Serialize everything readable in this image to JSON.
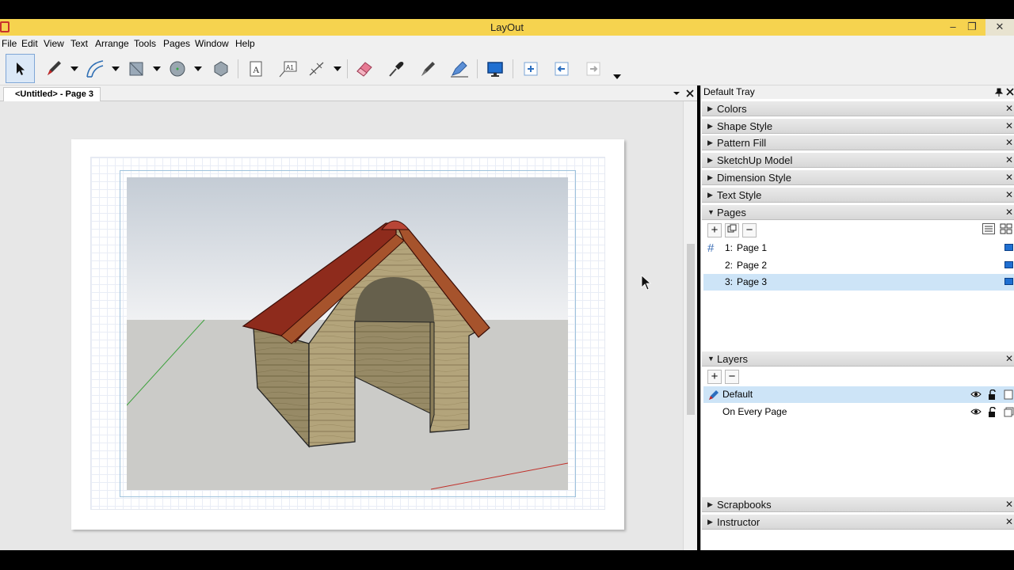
{
  "window": {
    "title": "LayOut",
    "minimize": "–",
    "restore": "❐",
    "close": "✕"
  },
  "menu": [
    "File",
    "Edit",
    "View",
    "Text",
    "Arrange",
    "Tools",
    "Pages",
    "Window",
    "Help"
  ],
  "toolbar": {
    "icons": [
      "select-arrow-icon",
      "pencil-icon",
      "arc-icon",
      "rectangle-icon",
      "circle-icon",
      "polygon-icon",
      "text-icon",
      "label-icon",
      "dimension-icon",
      "eraser-icon",
      "eyedropper-icon",
      "style-pen-icon",
      "split-icon",
      "presentation-icon",
      "add-page-icon",
      "previous-page-icon",
      "next-page-icon"
    ]
  },
  "document": {
    "tab_label": "<Untitled> - Page 3"
  },
  "tray": {
    "title": "Default Tray",
    "panels": {
      "colors": "Colors",
      "shape_style": "Shape Style",
      "pattern_fill": "Pattern Fill",
      "sketchup_model": "SketchUp Model",
      "dimension_style": "Dimension Style",
      "text_style": "Text Style",
      "pages": "Pages",
      "layers": "Layers",
      "scrapbooks": "Scrapbooks",
      "instructor": "Instructor"
    },
    "pages": {
      "hash": "#",
      "items": [
        {
          "num": "1:",
          "name": "Page 1"
        },
        {
          "num": "2:",
          "name": "Page 2"
        },
        {
          "num": "3:",
          "name": "Page 3"
        }
      ],
      "selected": "Page 3"
    },
    "layers": {
      "items": [
        {
          "name": "Default"
        },
        {
          "name": "On Every Page"
        }
      ],
      "selected": "Default"
    }
  },
  "colors": {
    "titlebar": "#f6d34f",
    "selection": "#cde4f7",
    "roof": "#8e2b1c",
    "wood": "#b6a77e"
  }
}
